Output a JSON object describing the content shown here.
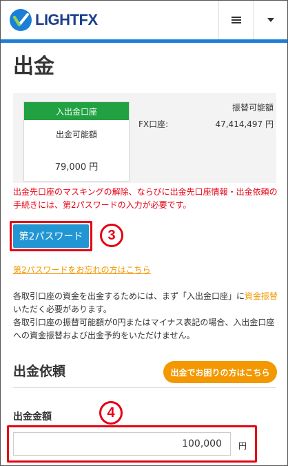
{
  "header": {
    "logo_text_light": "LIGHT",
    "logo_text_fx": "FX",
    "menu_icon": "hamburger-icon",
    "dropdown_icon": "caret-down-icon",
    "accent_color": "#1b7fd8"
  },
  "page_title": "出金",
  "summary": {
    "account_header": "入出金口座",
    "withdrawable_label": "出金可能額",
    "withdrawable_value": "79,000 円",
    "transfer_header": "振替可能額",
    "fx_label": "FX口座:",
    "fx_value": "47,414,497 円"
  },
  "warning_text": "出金先口座のマスキングの解除、ならびに出金先口座情報・出金依頼の手続きには、第2パスワードの入力が必要です。",
  "second_password_button": "第2パスワード",
  "badges": {
    "three": "3",
    "four": "4"
  },
  "forgot_link": "第2パスワードをお忘れの方はこちら",
  "info": {
    "p1_before": "各取引口座の資金を出金するためには、まず「入出金口座」に",
    "p1_link": "資金振替",
    "p1_after": "いただく必要があります。",
    "p2": "各取引口座の振替可能額が0円またはマイナス表記の場合、入出金口座への資金振替および出金予約をいただけません。"
  },
  "withdraw_request_title": "出金依頼",
  "help_button": "出金でお困りの方はこちら",
  "amount": {
    "label": "出金金額",
    "value": "100,000",
    "unit": "円"
  }
}
